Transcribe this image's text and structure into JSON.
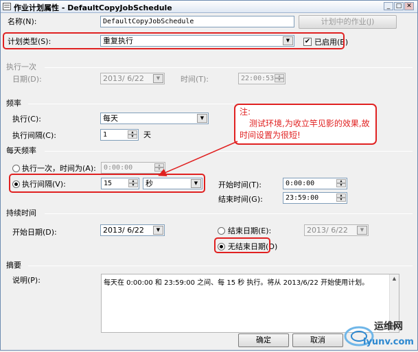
{
  "window": {
    "title": "作业计划属性 - DefaultCopyJobSchedule",
    "min": "_",
    "max": "□",
    "close": "✕"
  },
  "name": {
    "label": "名称(N):",
    "value": "DefaultCopyJobSchedule",
    "jobs_button": "计划中的作业(J)"
  },
  "schedule_type": {
    "label": "计划类型(S):",
    "value": "重复执行",
    "enabled_label": "已启用(B)",
    "enabled": true
  },
  "one_time": {
    "section": "执行一次",
    "date_label": "日期(D):",
    "date_value": "2013/ 6/22",
    "time_label": "时间(T):",
    "time_value": "22:00:53"
  },
  "frequency": {
    "section": "频率",
    "occurs_label": "执行(C):",
    "occurs_value": "每天",
    "recur_label": "执行间隔(C):",
    "recur_value": "1",
    "recur_unit": "天"
  },
  "daily": {
    "section": "每天频率",
    "once_label": "执行一次，时间为(A):",
    "once_value": "0:00:00",
    "every_label": "执行间隔(V):",
    "every_value": "15",
    "every_unit": "秒",
    "start_label": "开始时间(T):",
    "start_value": "0:00:00",
    "end_label": "结束时间(G):",
    "end_value": "23:59:00"
  },
  "duration": {
    "section": "持续时间",
    "start_date_label": "开始日期(D):",
    "start_date_value": "2013/ 6/22",
    "end_date_label": "结束日期(E):",
    "end_date_value": "2013/ 6/22",
    "no_end_label": "无结束日期(O)"
  },
  "summary": {
    "section": "摘要",
    "desc_label": "说明(P):",
    "desc_value": "每天在 0:00:00 和 23:59:00 之间、每 15 秒 执行。将从 2013/6/22 开始使用计划。"
  },
  "annotation": {
    "title": "注:",
    "body": "测试环境,为收立竿见影的效果,故时间设置为很短!"
  },
  "buttons": {
    "ok": "确定",
    "cancel": "取消"
  },
  "watermark": {
    "text1": "运维网",
    "text2": "iyunv.com"
  },
  "colors": {
    "highlight": "#e02020"
  }
}
